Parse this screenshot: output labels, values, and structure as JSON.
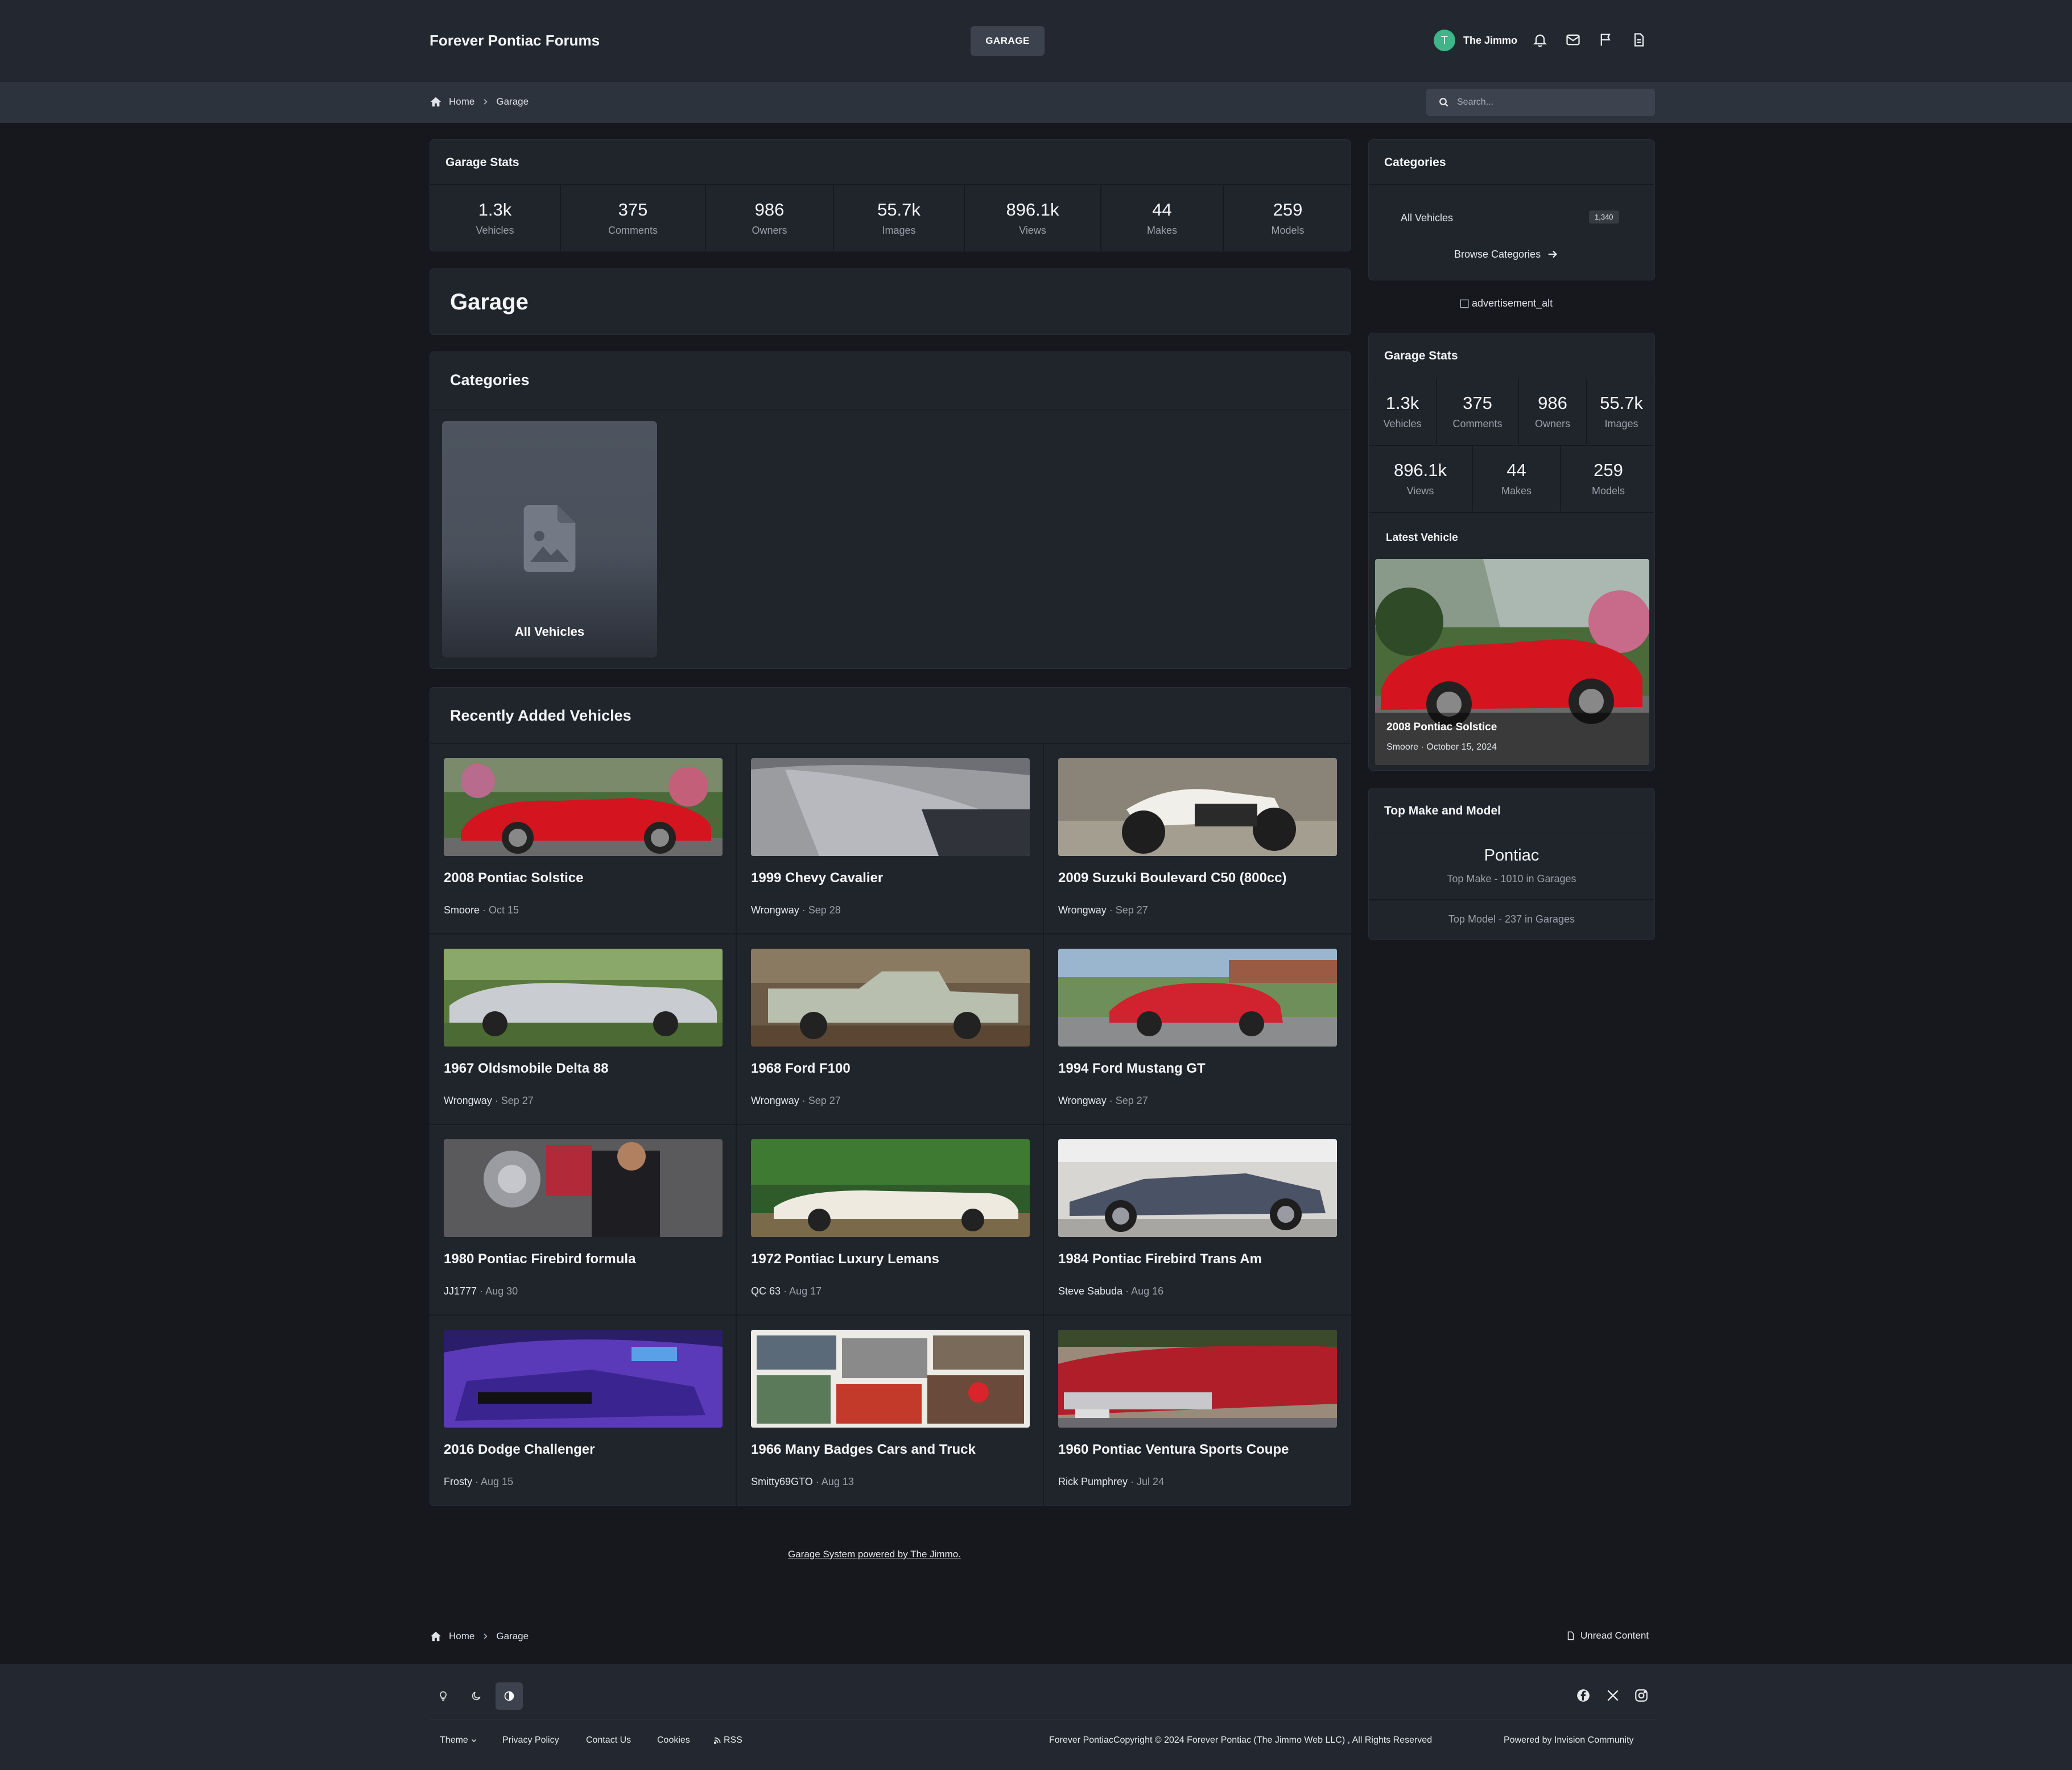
{
  "header": {
    "site_title": "Forever Pontiac Forums",
    "garage_button": "GARAGE",
    "user": {
      "initial": "T",
      "name": "The Jimmo",
      "avatar_color": "#3fb58a"
    },
    "icons": [
      "bell-icon",
      "mail-icon",
      "flag-icon",
      "document-icon"
    ]
  },
  "breadcrumb": {
    "home": "Home",
    "current": "Garage"
  },
  "search": {
    "placeholder": "Search..."
  },
  "garage_stats": {
    "title": "Garage Stats",
    "items": [
      {
        "value": "1.3k",
        "label": "Vehicles"
      },
      {
        "value": "375",
        "label": "Comments"
      },
      {
        "value": "986",
        "label": "Owners"
      },
      {
        "value": "55.7k",
        "label": "Images"
      },
      {
        "value": "896.1k",
        "label": "Views"
      },
      {
        "value": "44",
        "label": "Makes"
      },
      {
        "value": "259",
        "label": "Models"
      }
    ]
  },
  "page_title": "Garage",
  "categories_section": {
    "title": "Categories",
    "card_label": "All Vehicles"
  },
  "recent": {
    "title": "Recently Added Vehicles",
    "vehicles": [
      {
        "title": "2008 Pontiac Solstice",
        "owner": "Smoore",
        "date": "Oct 15"
      },
      {
        "title": "1999 Chevy Cavalier",
        "owner": "Wrongway",
        "date": "Sep 28"
      },
      {
        "title": "2009 Suzuki Boulevard C50 (800cc)",
        "owner": "Wrongway",
        "date": "Sep 27"
      },
      {
        "title": "1967 Oldsmobile Delta 88",
        "owner": "Wrongway",
        "date": "Sep 27"
      },
      {
        "title": "1968 Ford F100",
        "owner": "Wrongway",
        "date": "Sep 27"
      },
      {
        "title": "1994 Ford Mustang GT",
        "owner": "Wrongway",
        "date": "Sep 27"
      },
      {
        "title": "1980 Pontiac Firebird formula",
        "owner": "JJ1777",
        "date": "Aug 30"
      },
      {
        "title": "1972 Pontiac Luxury Lemans",
        "owner": "QC 63",
        "date": "Aug 17"
      },
      {
        "title": "1984 Pontiac Firebird Trans Am",
        "owner": "Steve Sabuda",
        "date": "Aug 16"
      },
      {
        "title": "2016 Dodge Challenger",
        "owner": "Frosty",
        "date": "Aug 15"
      },
      {
        "title": "1966 Many Badges Cars and Truck",
        "owner": "Smitty69GTO",
        "date": "Aug 13"
      },
      {
        "title": "1960 Pontiac Ventura Sports Coupe",
        "owner": "Rick Pumphrey",
        "date": "Jul 24"
      }
    ]
  },
  "powered_line": "Garage System powered by The Jimmo.",
  "sidebar": {
    "categories": {
      "title": "Categories",
      "all_vehicles": "All Vehicles",
      "count": "1,340",
      "browse": "Browse Categories"
    },
    "ad_alt": "advertisement_alt",
    "stats": {
      "title": "Garage Stats",
      "row1": [
        {
          "value": "1.3k",
          "label": "Vehicles"
        },
        {
          "value": "375",
          "label": "Comments"
        },
        {
          "value": "986",
          "label": "Owners"
        },
        {
          "value": "55.7k",
          "label": "Images"
        }
      ],
      "row2": [
        {
          "value": "896.1k",
          "label": "Views"
        },
        {
          "value": "44",
          "label": "Makes"
        },
        {
          "value": "259",
          "label": "Models"
        }
      ],
      "latest_title": "Latest Vehicle",
      "latest": {
        "title": "2008 Pontiac Solstice",
        "meta": "Smoore · October 15, 2024"
      }
    },
    "top": {
      "title": "Top Make and Model",
      "make": "Pontiac",
      "make_line": "Top Make - 1010 in Garages",
      "model_line": "Top Model - 237 in Garages"
    }
  },
  "bottom_crumbs": {
    "home": "Home",
    "current": "Garage",
    "unread": "Unread Content"
  },
  "footer": {
    "theme": "Theme",
    "links": [
      "Privacy Policy",
      "Contact Us",
      "Cookies",
      "RSS"
    ],
    "copyright": "Forever PontiacCopyright © 2024 Forever Pontiac (The Jimmo Web LLC) , All Rights Reserved",
    "powered": "Powered by Invision Community",
    "social": [
      "facebook-icon",
      "x-icon",
      "instagram-icon"
    ]
  },
  "colors": {
    "page_bg": "#16181d",
    "panel_bg": "#20242b",
    "header_bg": "#23272f",
    "accent_green": "#3fb58a"
  }
}
